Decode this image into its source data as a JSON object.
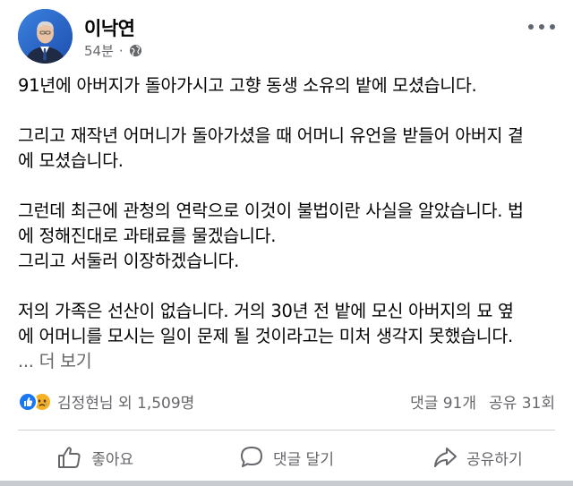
{
  "post": {
    "author": "이낙연",
    "time": "54분",
    "dot": "·",
    "paragraphs": [
      [
        "91년에 아버지가 돌아가시고 고향 동생 소유의 밭에 모셨습니다."
      ],
      [
        "그리고 재작년 어머니가 돌아가셨을 때 어머니 유언을 받들어 아버지 곁",
        "에 모셨습니다."
      ],
      [
        "그런데 최근에 관청의 연락으로 이것이 불법이란 사실을 알았습니다. 법",
        "에 정해진대로 과태료를 물겠습니다.",
        "그리고 서둘러 이장하겠습니다."
      ],
      [
        "저의 가족은 선산이 없습니다. 거의 30년 전 밭에 모신 아버지의 묘 옆",
        "에 어머니를 모시는 일이 문제 될 것이라고는 미처 생각지 못했습니다."
      ]
    ],
    "see_more": "... 더 보기"
  },
  "reactions": {
    "names": "김정현님 외 1,509명",
    "comments": "댓글 91개",
    "shares": "공유 31회"
  },
  "actions": {
    "like": "좋아요",
    "comment": "댓글 달기",
    "share": "공유하기"
  },
  "icons": {
    "globe": "globe-icon",
    "more": "more-options-icon",
    "like": "thumbs-up-icon",
    "comment": "comment-bubble-icon",
    "share": "share-arrow-icon",
    "reaction_like": "like-reaction-icon",
    "reaction_sad": "sad-reaction-icon"
  },
  "colors": {
    "primary_text": "#050505",
    "secondary_text": "#65676b",
    "like_blue": "#1877f2",
    "sad_yellow": "#f7b125",
    "divider": "#ced0d4"
  }
}
